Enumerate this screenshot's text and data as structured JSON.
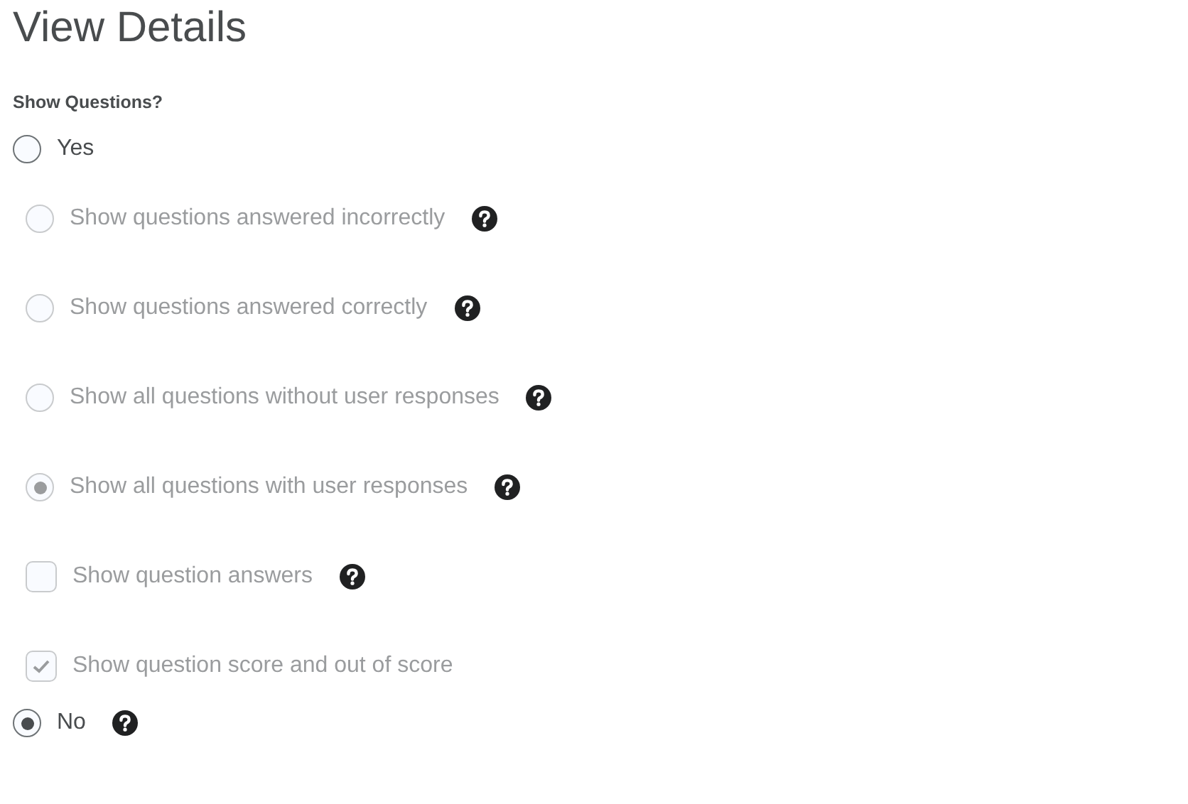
{
  "title": "View Details",
  "field_label": "Show Questions?",
  "options": [
    {
      "kind": "radio",
      "label": "Yes",
      "selected": false,
      "disabled": false,
      "help": false,
      "children": [
        {
          "kind": "radio",
          "label": "Show questions answered incorrectly",
          "selected": false,
          "disabled": true,
          "help": true
        },
        {
          "kind": "radio",
          "label": "Show questions answered correctly",
          "selected": false,
          "disabled": true,
          "help": true
        },
        {
          "kind": "radio",
          "label": "Show all questions without user responses",
          "selected": false,
          "disabled": true,
          "help": true
        },
        {
          "kind": "radio",
          "label": "Show all questions with user responses",
          "selected": true,
          "disabled": true,
          "help": true
        },
        {
          "kind": "checkbox",
          "label": "Show question answers",
          "checked": false,
          "disabled": true,
          "help": true
        },
        {
          "kind": "checkbox",
          "label": "Show question score and out of score",
          "checked": true,
          "disabled": true,
          "help": false
        }
      ]
    },
    {
      "kind": "radio",
      "label": "No",
      "selected": true,
      "disabled": false,
      "help": true
    }
  ]
}
